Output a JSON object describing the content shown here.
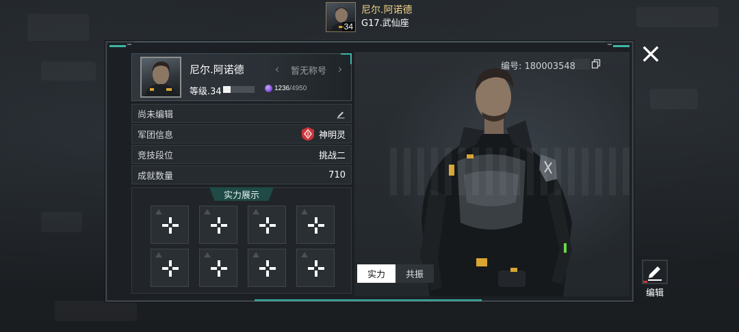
{
  "header": {
    "player_name": "尼尔.阿诺德",
    "level": "34",
    "server": "G17.武仙座"
  },
  "profile": {
    "name": "尼尔.阿诺德",
    "title": "暂无称号",
    "level_text": "等级.34",
    "exp_fraction": 0.249,
    "exp_current": "1236",
    "exp_max": "/4950"
  },
  "info": {
    "signature": "尚未编辑",
    "legion_label": "军团信息",
    "legion_value": "神明灵",
    "rank_label": "竞技段位",
    "rank_value": "挑战二",
    "achievement_label": "成就数量",
    "achievement_value": "710"
  },
  "showcase": {
    "title": "实力展示",
    "slot_count": 8
  },
  "character": {
    "id_text": "编号: 180003548"
  },
  "tabs": [
    {
      "label": "实力",
      "active": true
    },
    {
      "label": "共振",
      "active": false
    }
  ],
  "edit": {
    "label": "编辑"
  },
  "colors": {
    "accent": "#3fb8a8",
    "name_gold": "#f1d48a",
    "legion_red": "#c8353a"
  }
}
